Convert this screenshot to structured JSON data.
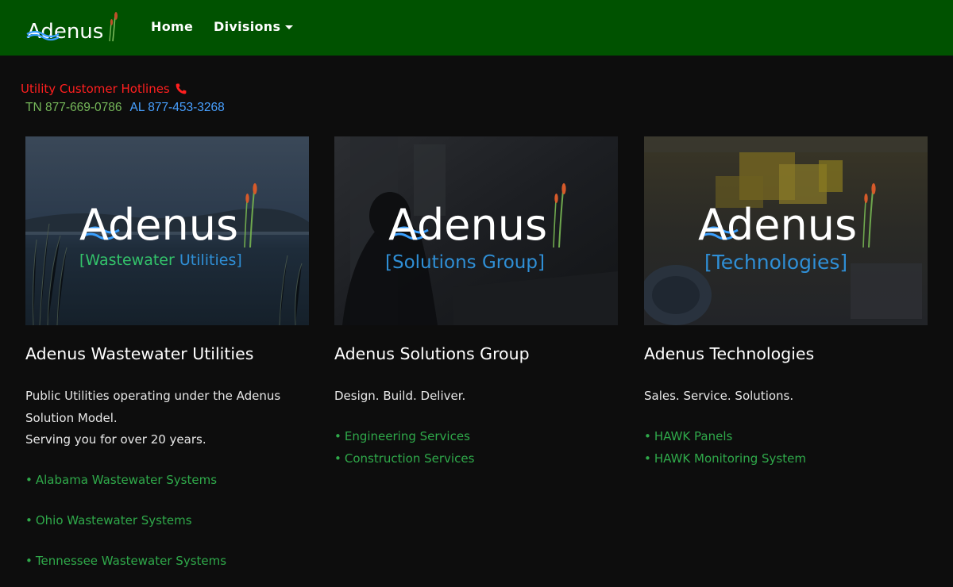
{
  "brand": {
    "logo_text": "Adenus"
  },
  "nav": {
    "home": "Home",
    "divisions": "Divisions"
  },
  "hotlines": {
    "title": "Utility Customer Hotlines",
    "tn": "TN 877-669-0786",
    "al": "AL 877-453-3268"
  },
  "colors": {
    "navbar": "#005200",
    "background": "#0d0d0d",
    "hotline_red": "#ff1f1f",
    "tn_green": "#76b85a",
    "al_blue": "#48a0ff",
    "link_green": "#2fa94a",
    "sub_blue": "#2f8fd6",
    "sub_green": "#33c26a"
  },
  "cards": [
    {
      "logo_word": "Adenus",
      "logo_sub_a": "[Wastewater ",
      "logo_sub_b": "Utilities]",
      "title": "Adenus Wastewater Utilities",
      "desc_line1": "Public Utilities operating under the Adenus",
      "desc_line2": "Solution Model.",
      "desc_line3": "Serving you for over 20 years.",
      "links": [
        "Alabama Wastewater Systems",
        "Ohio Wastewater Systems",
        "Tennessee Wastewater Systems"
      ]
    },
    {
      "logo_word": "Adenus",
      "logo_sub": "[Solutions Group]",
      "title": "Adenus Solutions Group",
      "desc": "Design. Build. Deliver.",
      "links": [
        "Engineering Services",
        "Construction Services"
      ]
    },
    {
      "logo_word": "Adenus",
      "logo_sub": "[Technologies]",
      "title": "Adenus Technologies",
      "desc": "Sales. Service. Solutions.",
      "links": [
        "HAWK Panels",
        "HAWK Monitoring System"
      ]
    }
  ]
}
